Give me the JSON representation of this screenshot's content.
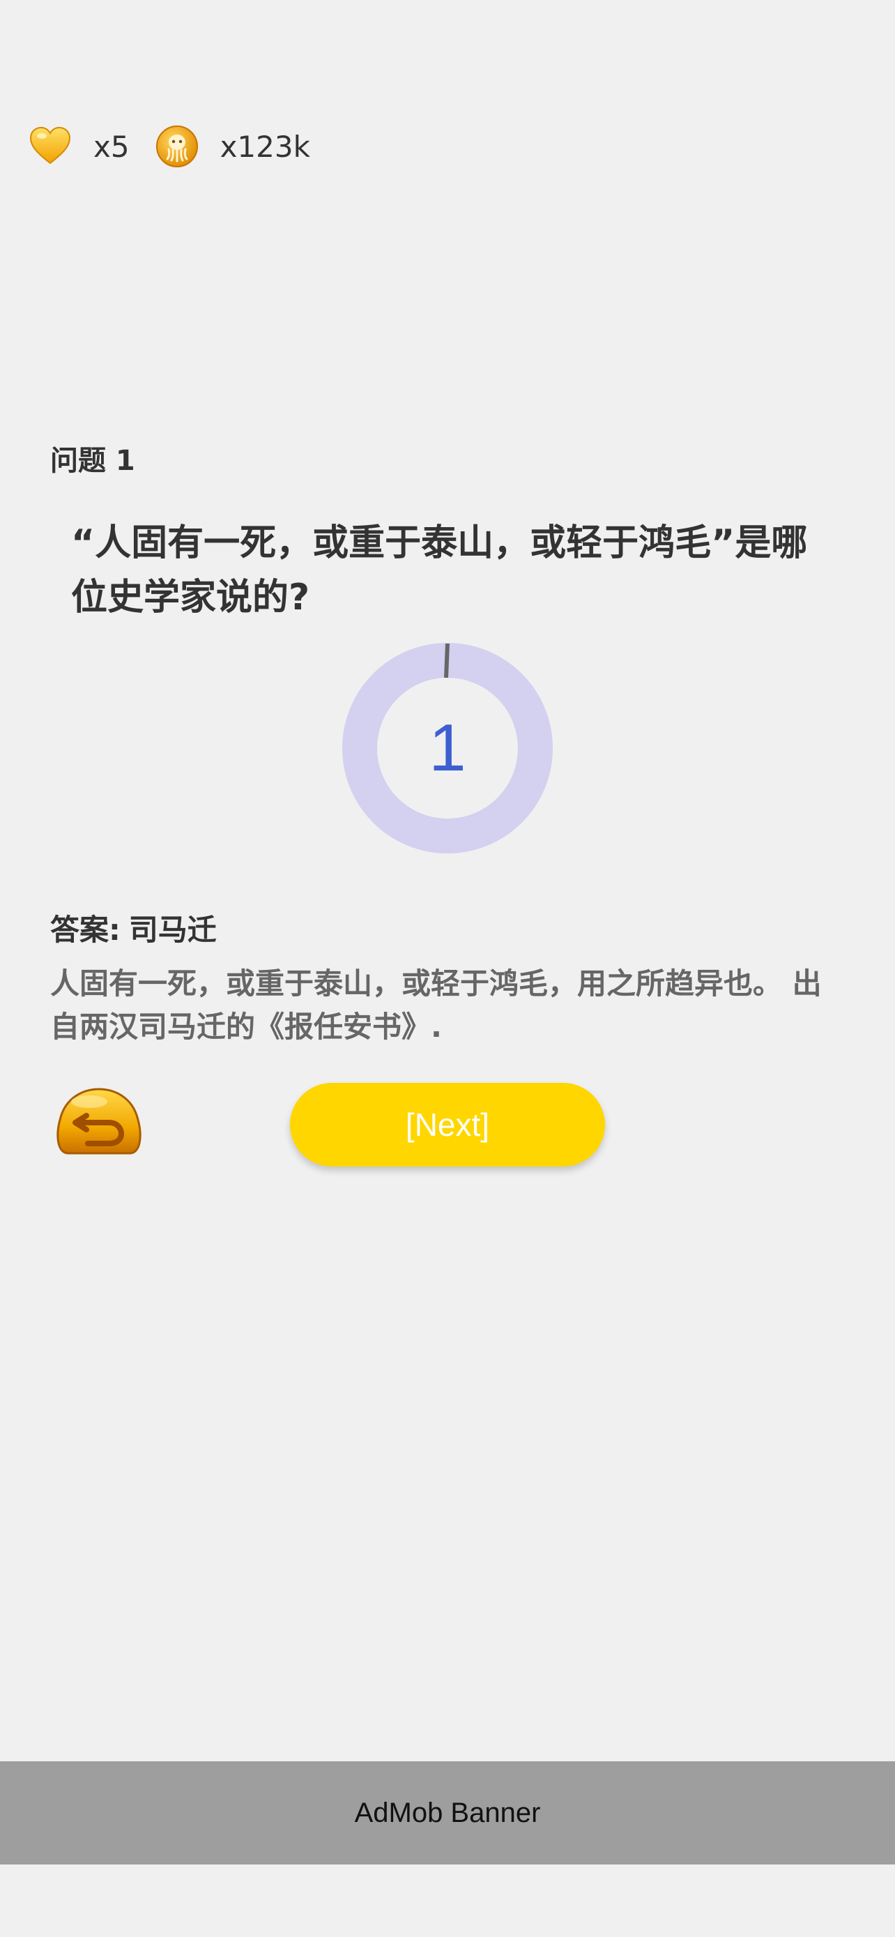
{
  "stats": {
    "hearts": {
      "icon": "heart-icon",
      "value": "x5",
      "color": "#f6b800"
    },
    "coins": {
      "icon": "octopus-coin-icon",
      "value": "x123k",
      "color": "#f2a900"
    }
  },
  "question": {
    "number_label": "问题 1",
    "text": "“人固有一死，或重于泰山，或轻于鸿毛”是哪位史学家说的?"
  },
  "timer": {
    "value": "1",
    "progress": 0.01,
    "ring_color": "#d3d0f0",
    "tick_color": "#666666",
    "number_color": "#3d5fd0"
  },
  "answer": {
    "label": "答案:",
    "value": "司马迁",
    "explanation": "人固有一死，或重于泰山，或轻于鸿毛，用之所趋异也。 出自两汉司马迁的《报任安书》."
  },
  "actions": {
    "back_icon": "undo-arrow-icon",
    "next_label": "[Next]",
    "next_color": "#ffd600"
  },
  "banner": {
    "label": "AdMob Banner"
  }
}
